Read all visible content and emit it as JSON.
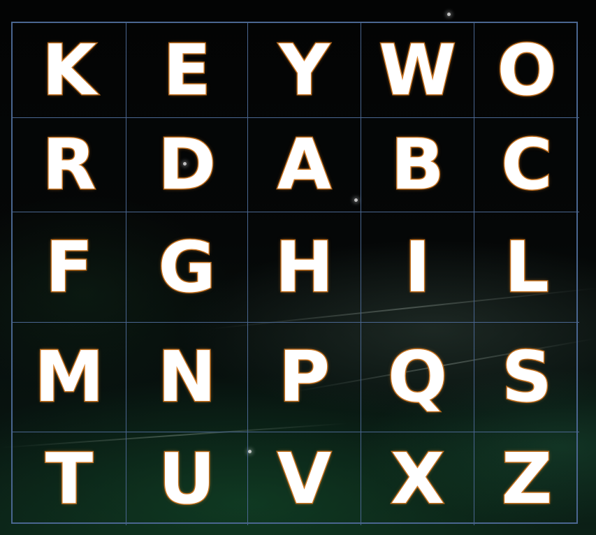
{
  "grid": {
    "rows": [
      [
        "K",
        "E",
        "Y",
        "W",
        "O"
      ],
      [
        "R",
        "D",
        "A",
        "B",
        "C"
      ],
      [
        "F",
        "G",
        "H",
        "I",
        "L"
      ],
      [
        "M",
        "N",
        "P",
        "Q",
        "S"
      ],
      [
        "T",
        "U",
        "V",
        "X",
        "Z"
      ]
    ]
  },
  "colors": {
    "letter_fill": "#ffffff",
    "letter_outline": "#b86a1c",
    "grid_lines": "#4a6690",
    "background": "#020304"
  }
}
